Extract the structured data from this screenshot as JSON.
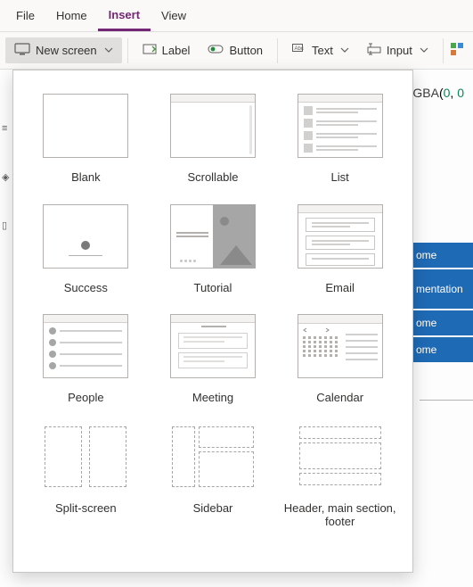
{
  "menubar": {
    "items": [
      "File",
      "Home",
      "Insert",
      "View"
    ],
    "active_index": 2
  },
  "ribbon": {
    "new_screen": "New screen",
    "label": "Label",
    "button": "Button",
    "text": "Text",
    "input": "Input"
  },
  "background": {
    "rgba_fn": "RGBA",
    "rgba_a": "0",
    "rgba_b": "0",
    "blue": [
      "ome",
      "mentatio",
      "n",
      "ome",
      "ome"
    ]
  },
  "panel": {
    "templates": [
      {
        "id": "blank",
        "label": "Blank"
      },
      {
        "id": "scrollable",
        "label": "Scrollable"
      },
      {
        "id": "list",
        "label": "List"
      },
      {
        "id": "success",
        "label": "Success"
      },
      {
        "id": "tutorial",
        "label": "Tutorial"
      },
      {
        "id": "email",
        "label": "Email"
      },
      {
        "id": "people",
        "label": "People"
      },
      {
        "id": "meeting",
        "label": "Meeting"
      },
      {
        "id": "calendar",
        "label": "Calendar"
      },
      {
        "id": "split",
        "label": "Split-screen"
      },
      {
        "id": "sidebar",
        "label": "Sidebar"
      },
      {
        "id": "hmf",
        "label": "Header, main section, footer"
      }
    ]
  }
}
